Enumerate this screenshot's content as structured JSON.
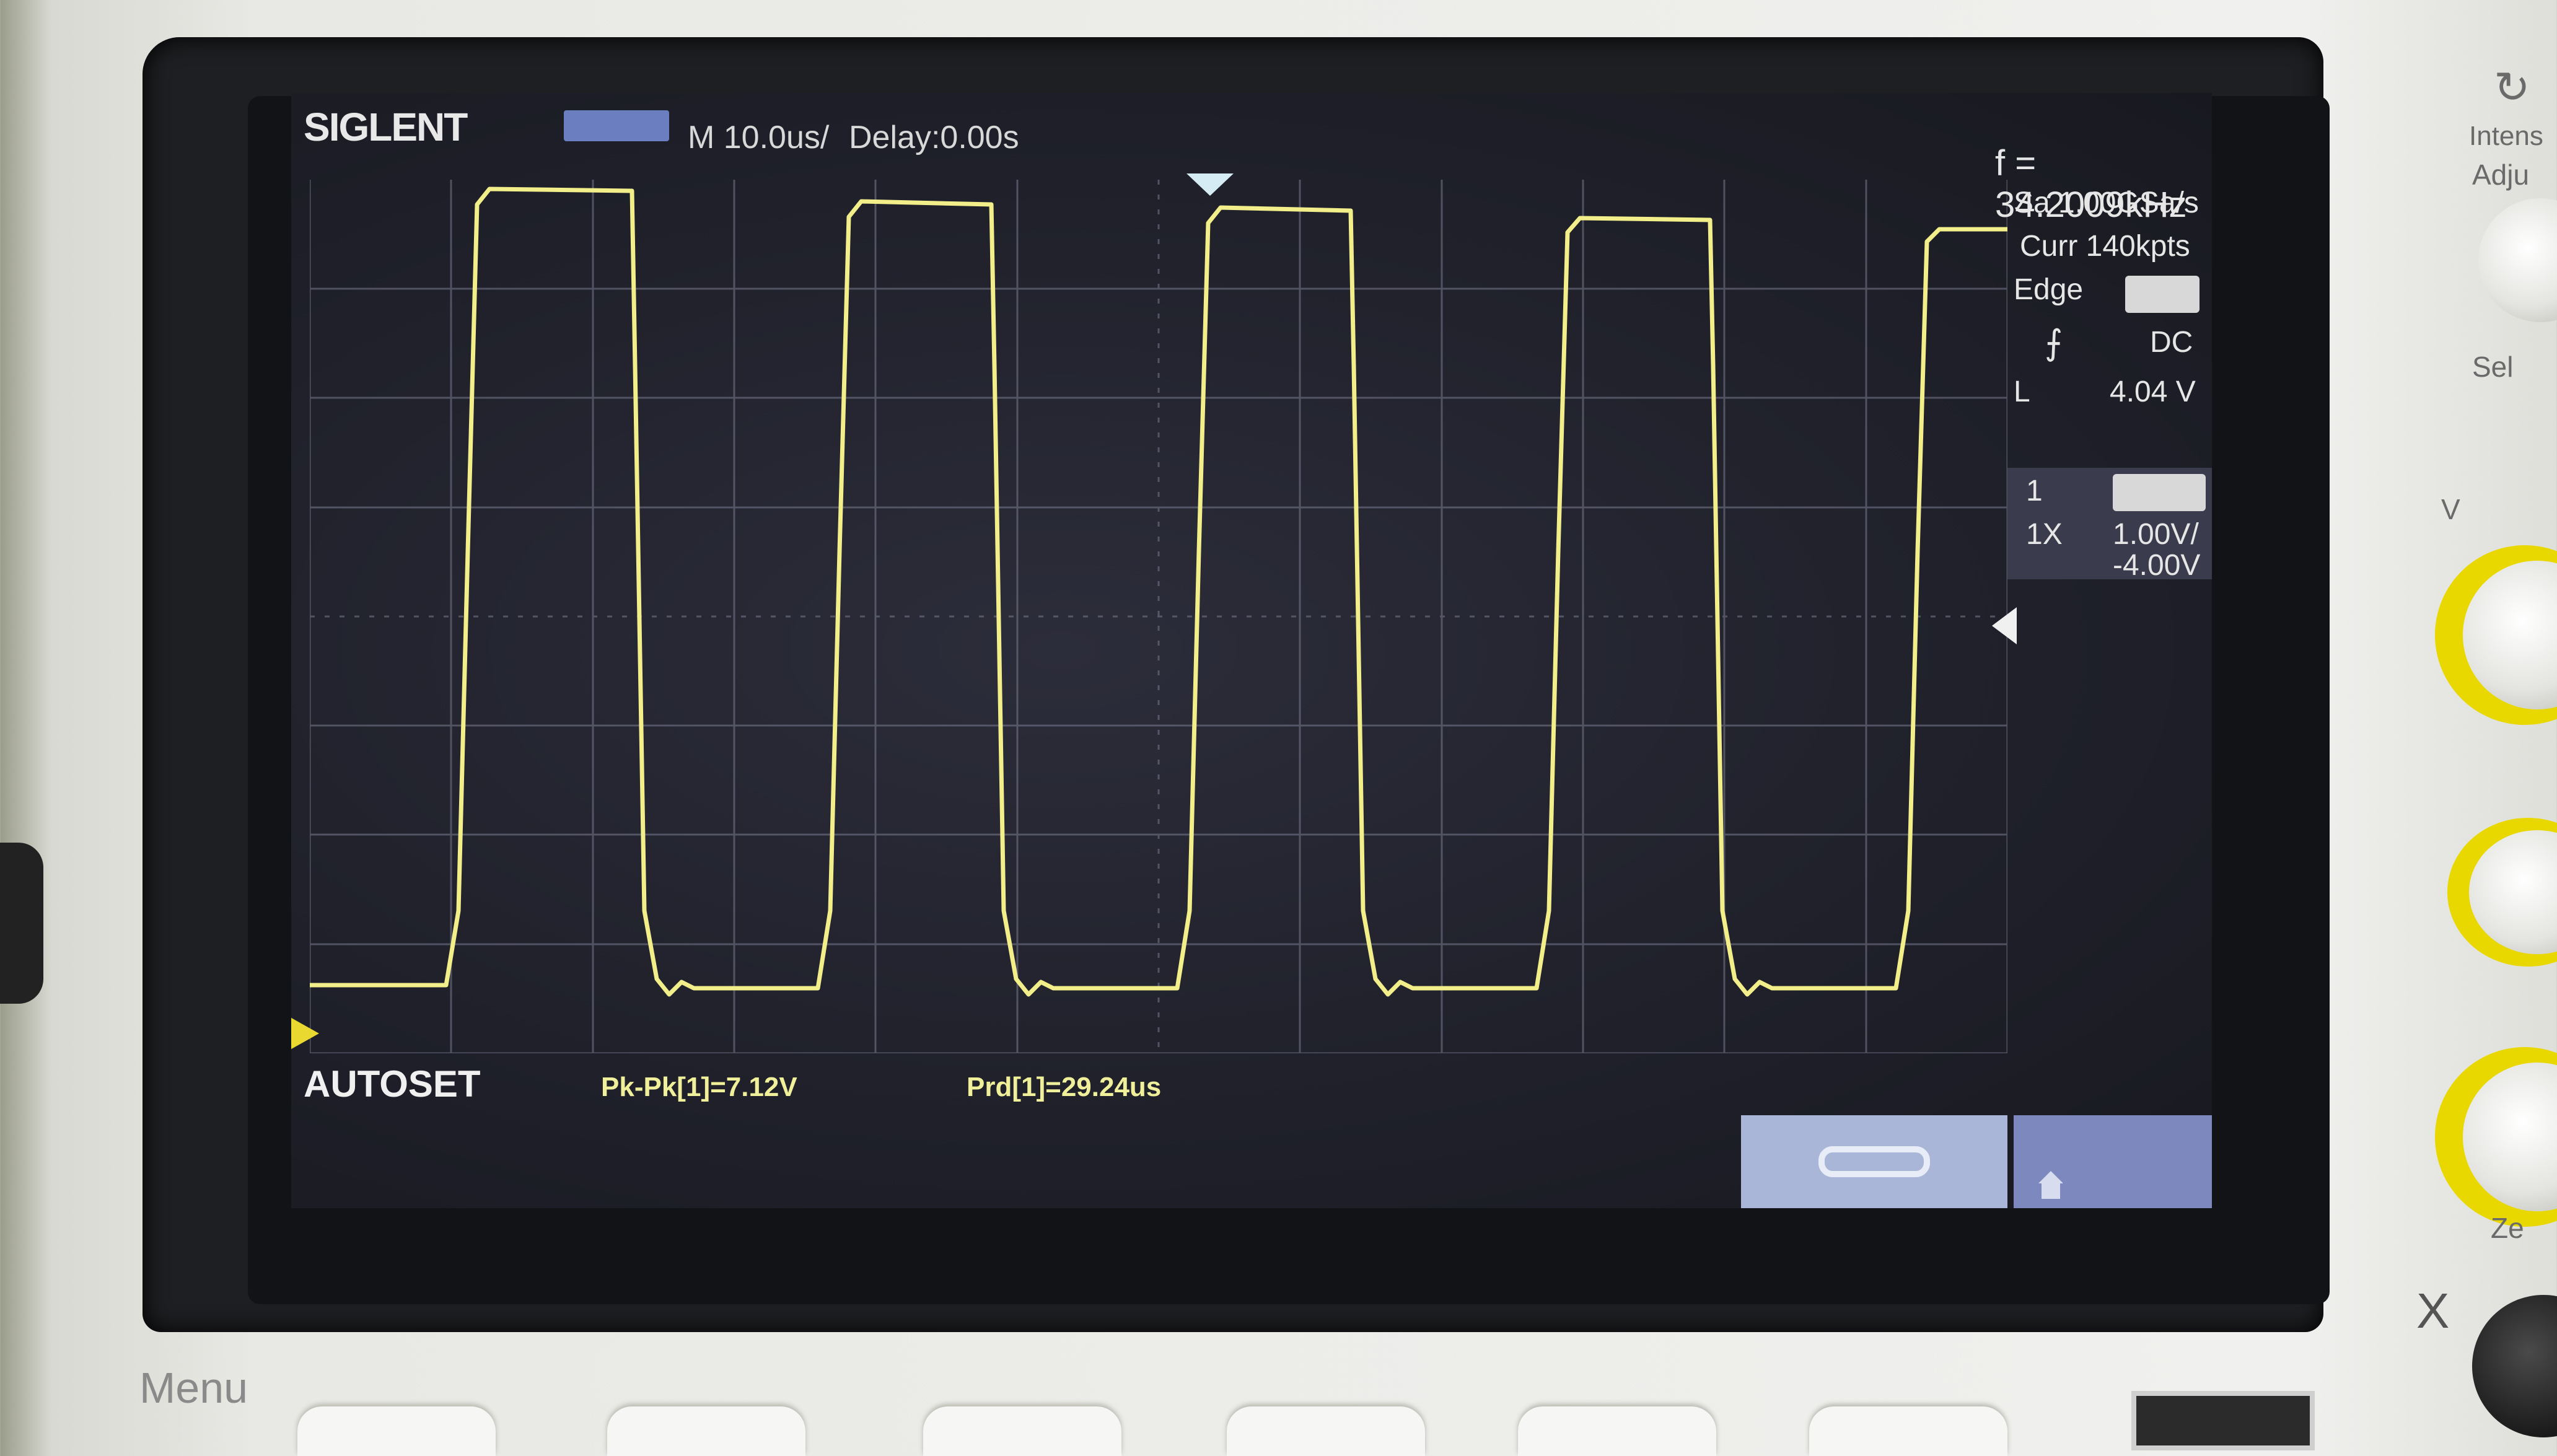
{
  "header": {
    "brand": "SIGLENT",
    "timebase": "M 10.0us/",
    "delay": "Delay:0.00s"
  },
  "trigger_panel": {
    "frequency": "f = 34.2009kHz",
    "sample_rate": "Sa 1.00GSa/s",
    "memory": "Curr 140kpts",
    "type_label": "Edge",
    "coupling": "DC",
    "level_prefix": "L",
    "level": "4.04 V"
  },
  "channel_panel": {
    "channel": "1",
    "probe": "1X",
    "scale": "1.00V/",
    "offset": "-4.00V"
  },
  "measurements": {
    "autoset": "AUTOSET",
    "pk_pk": "Pk-Pk[1]=7.12V",
    "period": "Prd[1]=29.24us"
  },
  "front_panel": {
    "menu": "Menu",
    "intensity": "Intens",
    "adjust": "Adju",
    "select": "Sel",
    "zero": "Ze",
    "v_label": "V",
    "x_label": "X"
  },
  "colors": {
    "trace": "#f2ee8a",
    "grid": "#7a7c90",
    "screen": "#20212b"
  }
}
